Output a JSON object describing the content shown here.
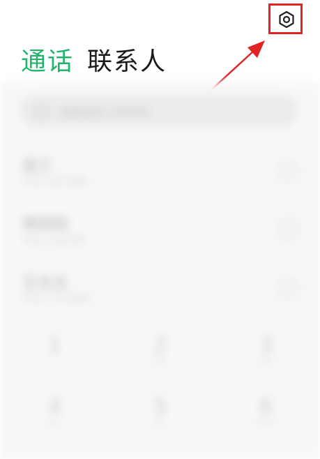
{
  "tabs": {
    "calls_label": "通话",
    "contacts_label": "联系人"
  },
  "settings_icon": "gear-icon",
  "colors": {
    "active_tab": "#23b36b",
    "highlight": "#e02424",
    "background": "#f7f7f7"
  },
  "search": {
    "placeholder": "搜索联系人和号码"
  },
  "call_log": [
    {
      "name": "张三",
      "sub": "手机 北京 刚刚"
    },
    {
      "name": "李四四",
      "sub": "手机 上海 昨天"
    },
    {
      "name": "王五五",
      "sub": "手机 广州 星期一"
    }
  ],
  "dialpad": [
    {
      "digit": "1",
      "letters": ""
    },
    {
      "digit": "2",
      "letters": "ABC"
    },
    {
      "digit": "3",
      "letters": "DEF"
    },
    {
      "digit": "4",
      "letters": "GHI"
    },
    {
      "digit": "5",
      "letters": "JKL"
    },
    {
      "digit": "6",
      "letters": "MNO"
    }
  ]
}
